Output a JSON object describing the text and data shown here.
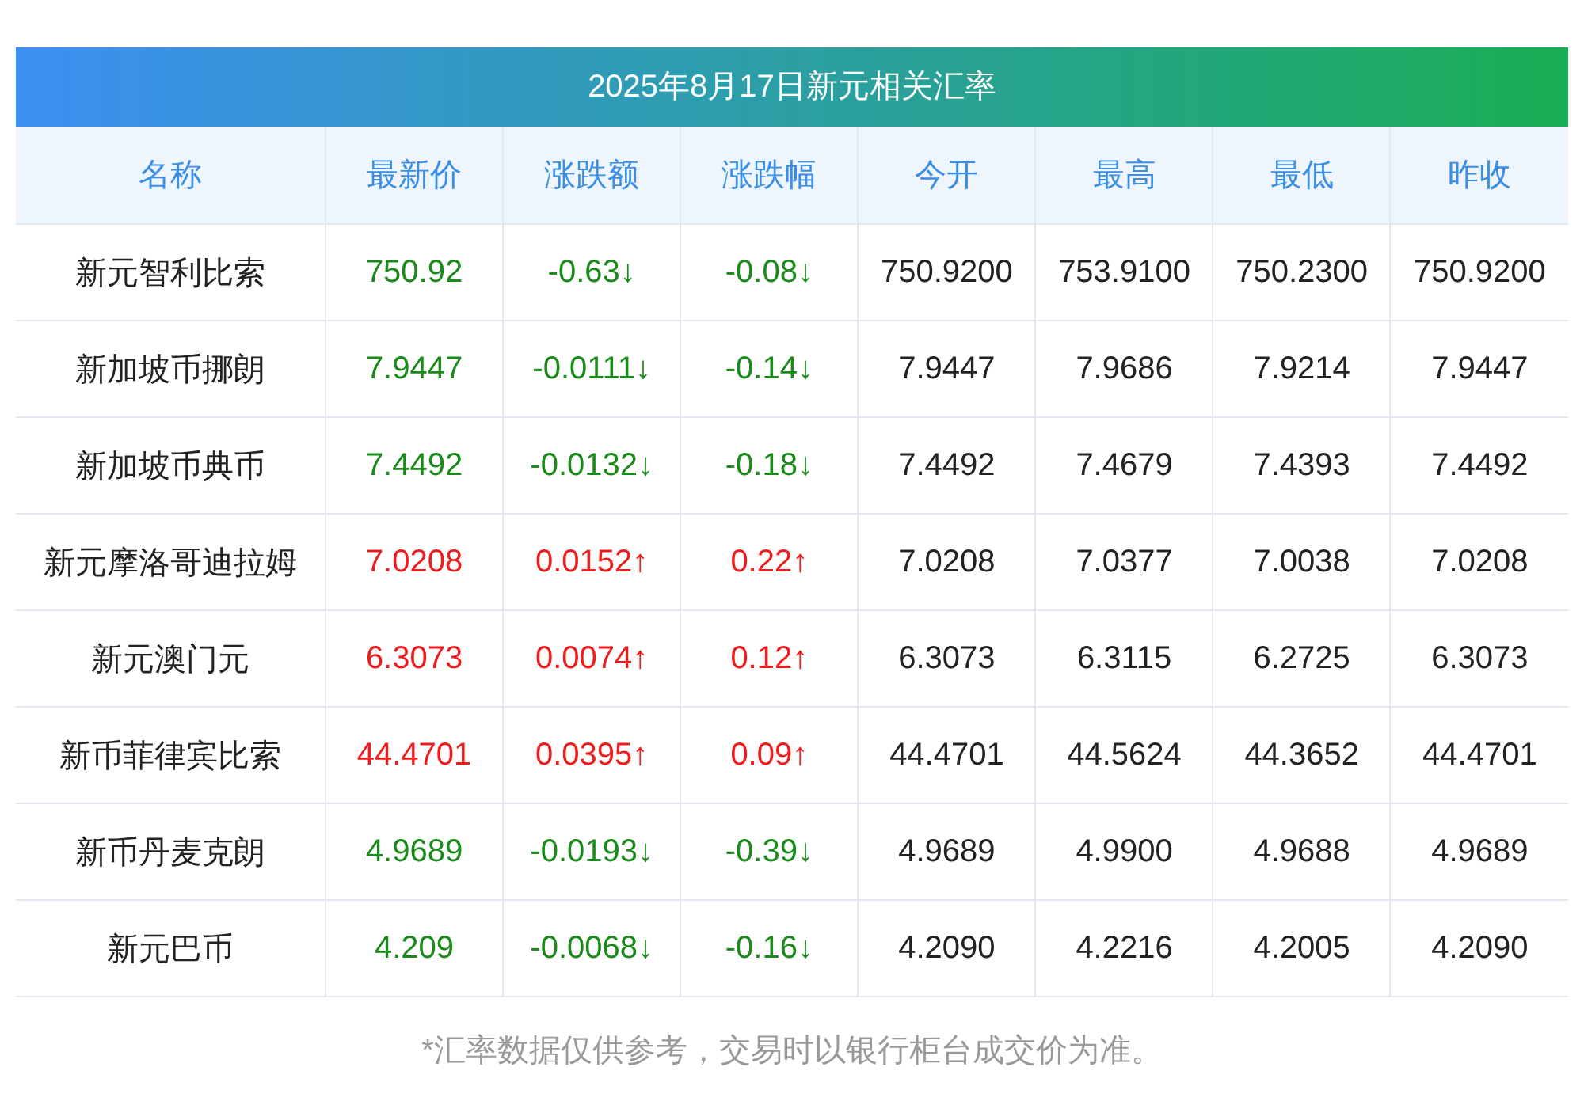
{
  "title": "2025年8月17日新元相关汇率",
  "columns": [
    "名称",
    "最新价",
    "涨跌额",
    "涨跌幅",
    "今开",
    "最高",
    "最低",
    "昨收"
  ],
  "rows": [
    {
      "kind": "down",
      "cells": [
        "新元智利比索",
        "750.92",
        "-0.63↓",
        "-0.08↓",
        "750.9200",
        "753.9100",
        "750.2300",
        "750.9200"
      ]
    },
    {
      "kind": "down",
      "cells": [
        "新加坡币挪朗",
        "7.9447",
        "-0.0111↓",
        "-0.14↓",
        "7.9447",
        "7.9686",
        "7.9214",
        "7.9447"
      ]
    },
    {
      "kind": "down",
      "cells": [
        "新加坡币典币",
        "7.4492",
        "-0.0132↓",
        "-0.18↓",
        "7.4492",
        "7.4679",
        "7.4393",
        "7.4492"
      ]
    },
    {
      "kind": "up",
      "cells": [
        "新元摩洛哥迪拉姆",
        "7.0208",
        "0.0152↑",
        "0.22↑",
        "7.0208",
        "7.0377",
        "7.0038",
        "7.0208"
      ]
    },
    {
      "kind": "up",
      "cells": [
        "新元澳门元",
        "6.3073",
        "0.0074↑",
        "0.12↑",
        "6.3073",
        "6.3115",
        "6.2725",
        "6.3073"
      ]
    },
    {
      "kind": "up",
      "cells": [
        "新币菲律宾比索",
        "44.4701",
        "0.0395↑",
        "0.09↑",
        "44.4701",
        "44.5624",
        "44.3652",
        "44.4701"
      ]
    },
    {
      "kind": "down",
      "cells": [
        "新币丹麦克朗",
        "4.9689",
        "-0.0193↓",
        "-0.39↓",
        "4.9689",
        "4.9900",
        "4.9688",
        "4.9689"
      ]
    },
    {
      "kind": "down",
      "cells": [
        "新元巴币",
        "4.209",
        "-0.0068↓",
        "-0.16↓",
        "4.2090",
        "4.2216",
        "4.2005",
        "4.2090"
      ]
    }
  ],
  "footnote": "*汇率数据仅供参考，交易时以银行柜台成交价为准。"
}
